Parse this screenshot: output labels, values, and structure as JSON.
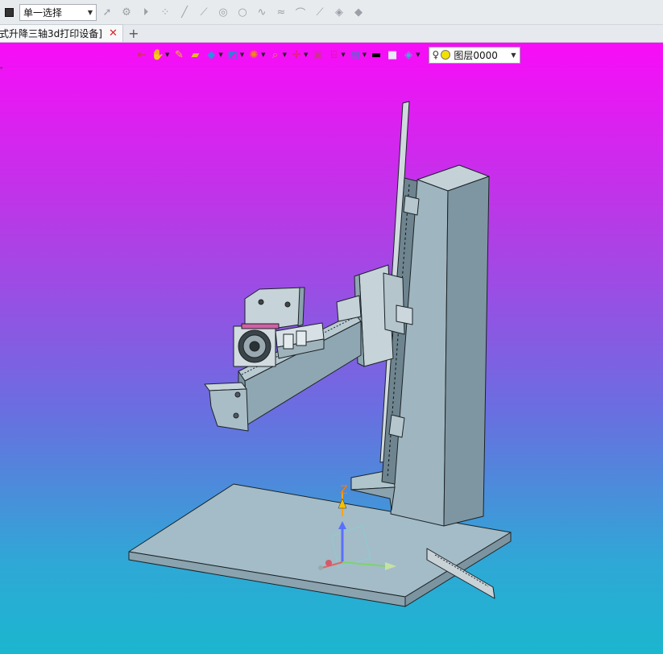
{
  "filter_bar": {
    "select_value": "单一选择"
  },
  "tab_bar": {
    "doc_tab_label": "式升降三轴3d打印设备]",
    "close_glyph": "✕",
    "add_glyph": "+"
  },
  "view_toolbar": {
    "layer_label": "图层0000"
  },
  "axis": {
    "z_label": "Z"
  },
  "viewport": {
    "corner_text": "。"
  },
  "colors": {
    "gradient_top": "#f90cf8",
    "gradient_bottom": "#1bb6cf",
    "model_face": "#a3bcc7",
    "model_edge": "#1b2327"
  }
}
